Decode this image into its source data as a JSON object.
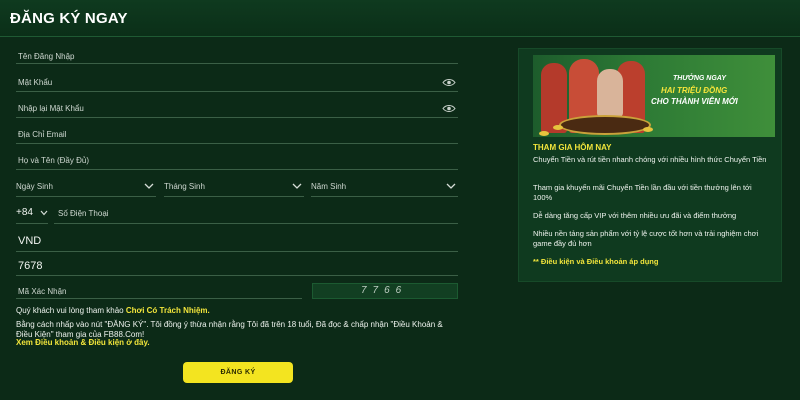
{
  "header": {
    "title": "ĐĂNG KÝ NGAY"
  },
  "form": {
    "username_placeholder": "Tên Đăng Nhập",
    "password_placeholder": "Mật Khẩu",
    "confirm_password_placeholder": "Nhập lại Mật Khẩu",
    "email_placeholder": "Địa Chỉ Email",
    "fullname_placeholder": "Họ và Tên (Đầy Đủ)",
    "dob": {
      "day_placeholder": "Ngày Sinh",
      "month_placeholder": "Tháng Sinh",
      "year_placeholder": "Năm Sinh"
    },
    "phone_code": "+84",
    "phone_placeholder": "Số Điện Thoại",
    "currency_value": "VND",
    "code_value": "7678",
    "captcha_placeholder": "Mã Xác Nhận",
    "captcha_code": "7766"
  },
  "notes": {
    "line1_prefix": "Quý khách vui lòng tham khảo ",
    "line1_link": "Chơi Có Trách Nhiệm.",
    "line2": "Bằng cách nhấp vào nút \"ĐĂNG KÝ\". Tôi đồng ý thừa nhận rằng Tôi đã trên 18 tuổi, Đã đọc & chấp nhận \"Điều Khoản & Điều Kiện\" tham gia của FB88.Com!",
    "line3_link": "Xem Điều khoản & Điều kiện ở đây."
  },
  "submit_label": "ĐĂNG KÝ",
  "promo": {
    "banner": {
      "line1": "THƯỞNG NGAY",
      "line2": "HAI TRIỆU ĐỒNG",
      "line3": "CHO THÀNH VIÊN MỚI"
    },
    "title": "THAM GIA HÔM NAY",
    "items": [
      "Chuyển Tiền và rút tiền nhanh chóng với nhiều hình thức Chuyển Tiền",
      "Tham gia khuyến mãi Chuyển Tiền lần đầu với tiền thưởng lên tới 100%",
      "Dễ dàng tăng cấp VIP với thêm nhiều ưu đãi và điểm thưởng",
      "Nhiều nền tảng sản phẩm với tỷ lệ cược tốt hơn và trải nghiệm chơi game đầy đủ hơn"
    ],
    "footer": "** Điều kiện và Điều khoản áp dụng"
  },
  "colors": {
    "background": "#0c2a17",
    "panel": "#0f3a1f",
    "accent_yellow": "#f3e420",
    "divider": "#3b5f46"
  }
}
